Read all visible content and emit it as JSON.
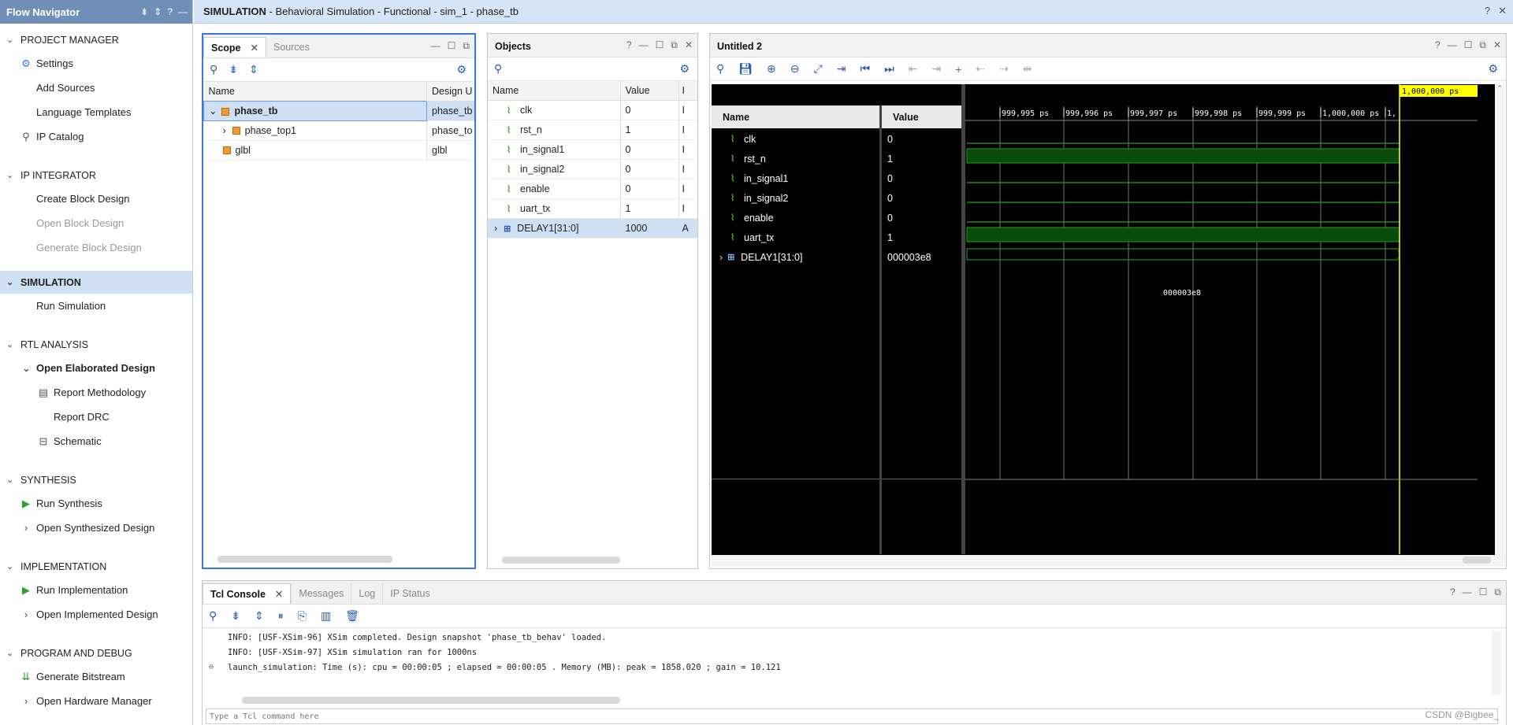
{
  "flow_nav": {
    "title": "Flow Navigator",
    "sections": [
      {
        "label": "PROJECT MANAGER",
        "items": [
          {
            "label": "Settings",
            "icon": "gear-icon"
          },
          {
            "label": "Add Sources"
          },
          {
            "label": "Language Templates"
          },
          {
            "label": "IP Catalog",
            "icon": "ip-icon"
          }
        ]
      },
      {
        "label": "IP INTEGRATOR",
        "items": [
          {
            "label": "Create Block Design"
          },
          {
            "label": "Open Block Design",
            "disabled": true
          },
          {
            "label": "Generate Block Design",
            "disabled": true
          }
        ]
      },
      {
        "label": "SIMULATION",
        "items": [
          {
            "label": "Run Simulation"
          }
        ]
      },
      {
        "label": "RTL ANALYSIS",
        "items": [
          {
            "label": "Open Elaborated Design"
          },
          {
            "label": "Report Methodology"
          },
          {
            "label": "Report DRC"
          },
          {
            "label": "Schematic"
          }
        ]
      },
      {
        "label": "SYNTHESIS",
        "items": [
          {
            "label": "Run Synthesis"
          },
          {
            "label": "Open Synthesized Design"
          }
        ]
      },
      {
        "label": "IMPLEMENTATION",
        "items": [
          {
            "label": "Run Implementation"
          },
          {
            "label": "Open Implemented Design"
          }
        ]
      },
      {
        "label": "PROGRAM AND DEBUG",
        "items": [
          {
            "label": "Generate Bitstream"
          },
          {
            "label": "Open Hardware Manager"
          }
        ]
      }
    ]
  },
  "main_title": {
    "bold": "SIMULATION",
    "rest": " - Behavioral Simulation - Functional - sim_1 - phase_tb"
  },
  "scope": {
    "tab_scope": "Scope",
    "tab_sources": "Sources",
    "col_name": "Name",
    "col_design": "Design U",
    "rows": [
      {
        "name": "phase_tb",
        "design": "phase_tb"
      },
      {
        "name": "phase_top1",
        "design": "phase_to"
      },
      {
        "name": "glbl",
        "design": "glbl"
      }
    ]
  },
  "objects": {
    "title": "Objects",
    "col_name": "Name",
    "col_value": "Value",
    "col_extra": "I",
    "rows": [
      {
        "name": "clk",
        "value": "0",
        "extra": "I"
      },
      {
        "name": "rst_n",
        "value": "1",
        "extra": "I"
      },
      {
        "name": "in_signal1",
        "value": "0",
        "extra": "I"
      },
      {
        "name": "in_signal2",
        "value": "0",
        "extra": "I"
      },
      {
        "name": "enable",
        "value": "0",
        "extra": "I"
      },
      {
        "name": "uart_tx",
        "value": "1",
        "extra": "I"
      },
      {
        "name": "DELAY1[31:0]",
        "value": "1000",
        "extra": "A"
      }
    ]
  },
  "wave": {
    "title": "Untitled 2",
    "col_name": "Name",
    "col_value": "Value",
    "cursor_label": "1,000,000 ps",
    "ticks": [
      "999,995 ps",
      "999,996 ps",
      "999,997 ps",
      "999,998 ps",
      "999,999 ps",
      "1,000,000 ps",
      "1,"
    ],
    "signals": [
      {
        "name": "clk",
        "value": "0"
      },
      {
        "name": "rst_n",
        "value": "1"
      },
      {
        "name": "in_signal1",
        "value": "0"
      },
      {
        "name": "in_signal2",
        "value": "0"
      },
      {
        "name": "enable",
        "value": "0"
      },
      {
        "name": "uart_tx",
        "value": "1"
      },
      {
        "name": "DELAY1[31:0]",
        "value": "000003e8"
      }
    ],
    "bus_label": "000003e8",
    "colors": {
      "wave": "#1d8a1d",
      "fill": "#0a4a0a",
      "cursor": "#ffff00"
    }
  },
  "tcl": {
    "tabs": [
      "Tcl Console",
      "Messages",
      "Log",
      "IP Status"
    ],
    "lines": [
      "INFO: [USF-XSim-96] XSim completed. Design snapshot 'phase_tb_behav' loaded.",
      "INFO: [USF-XSim-97] XSim simulation ran for 1000ns",
      "launch_simulation: Time (s): cpu = 00:00:05 ; elapsed = 00:00:05 . Memory (MB): peak = 1858.020 ; gain = 10.121"
    ],
    "input_placeholder": "Type a Tcl command here"
  },
  "watermark": "CSDN @Bigbee_"
}
